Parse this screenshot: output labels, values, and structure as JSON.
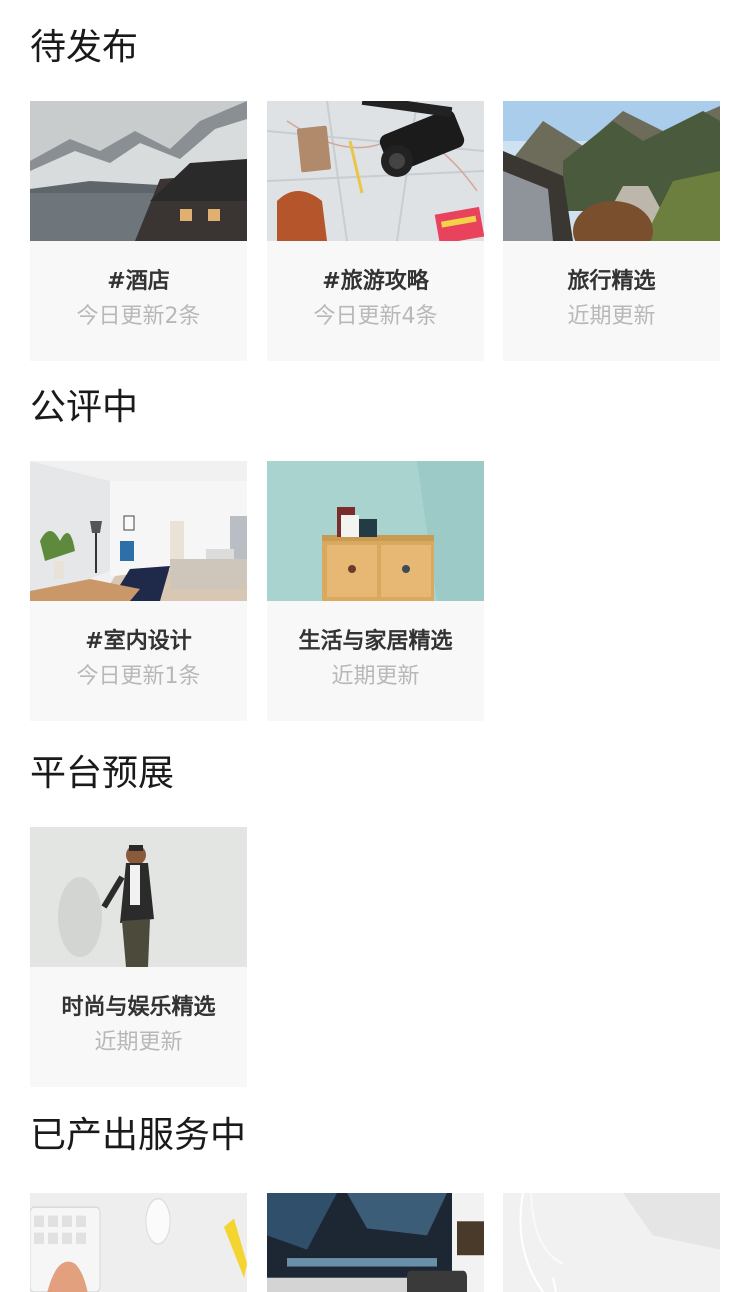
{
  "sections": [
    {
      "title": "待发布",
      "cards": [
        {
          "name": "#酒店",
          "sub": "今日更新2条",
          "image": "mountain-lake-cabin-image"
        },
        {
          "name": "#旅游攻略",
          "sub": "今日更新4条",
          "image": "map-camera-notebook-image"
        },
        {
          "name": "旅行精选",
          "sub": "近期更新",
          "image": "car-window-mountain-road-image"
        }
      ]
    },
    {
      "title": "公评中",
      "cards": [
        {
          "name": "#室内设计",
          "sub": "今日更新1条",
          "image": "bright-bedroom-interior-image"
        },
        {
          "name": "生活与家居精选",
          "sub": "近期更新",
          "image": "wooden-drawer-mugs-image"
        }
      ]
    },
    {
      "title": "平台预展",
      "cards": [
        {
          "name": "时尚与娱乐精选",
          "sub": "近期更新",
          "image": "fashion-man-leaning-wall-image"
        }
      ]
    },
    {
      "title": "已产出服务中",
      "cards": [
        {
          "image": "keyboard-hand-mouse-image"
        },
        {
          "image": "computer-monitor-desk-image"
        },
        {
          "image": "earphones-sunglasses-desk-image"
        }
      ]
    }
  ]
}
